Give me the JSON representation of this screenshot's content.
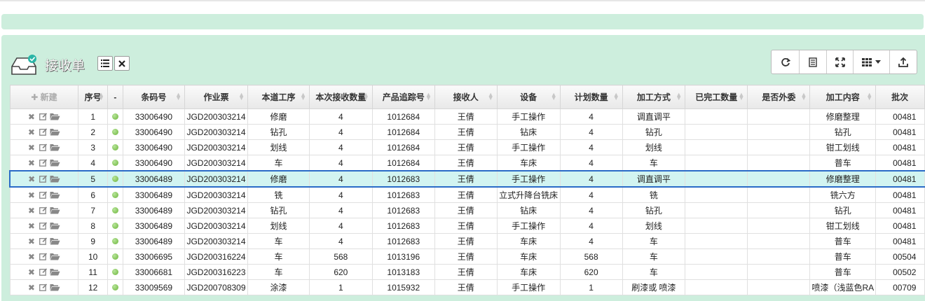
{
  "panel": {
    "title": "接收单",
    "list_icon": "list-icon",
    "close_icon": "close-icon"
  },
  "toolbar": {
    "items": [
      "refresh-icon",
      "document-icon",
      "fullscreen-icon",
      "grid-columns-dropdown-icon",
      "export-icon"
    ]
  },
  "table": {
    "new_label": "新建",
    "columns": [
      "序号",
      "-",
      "条码号",
      "作业票",
      "本道工序",
      "本次接收数量",
      "产品追踪号",
      "接收人",
      "设备",
      "计划数量",
      "加工方式",
      "已完工数量",
      "是否外委",
      "加工内容",
      "批次"
    ],
    "rows": [
      {
        "seq": "1",
        "barcode": "33006490",
        "ticket": "JGD200303214",
        "process": "修磨",
        "qty": "4",
        "track": "1012684",
        "receiver": "王倩",
        "device": "手工操作",
        "plan": "4",
        "method": "调直调平",
        "done": "",
        "outsource": "",
        "content": "修磨整理",
        "batch": "00481"
      },
      {
        "seq": "2",
        "barcode": "33006490",
        "ticket": "JGD200303214",
        "process": "钻孔",
        "qty": "4",
        "track": "1012684",
        "receiver": "王倩",
        "device": "钻床",
        "plan": "4",
        "method": "钻孔",
        "done": "",
        "outsource": "",
        "content": "钻孔",
        "batch": "00481"
      },
      {
        "seq": "3",
        "barcode": "33006490",
        "ticket": "JGD200303214",
        "process": "划线",
        "qty": "4",
        "track": "1012684",
        "receiver": "王倩",
        "device": "手工操作",
        "plan": "4",
        "method": "划线",
        "done": "",
        "outsource": "",
        "content": "钳工划线",
        "batch": "00481"
      },
      {
        "seq": "4",
        "barcode": "33006490",
        "ticket": "JGD200303214",
        "process": "车",
        "qty": "4",
        "track": "1012684",
        "receiver": "王倩",
        "device": "车床",
        "plan": "4",
        "method": "车",
        "done": "",
        "outsource": "",
        "content": "普车",
        "batch": "00481"
      },
      {
        "seq": "5",
        "barcode": "33006489",
        "ticket": "JGD200303214",
        "process": "修磨",
        "qty": "4",
        "track": "1012683",
        "receiver": "王倩",
        "device": "手工操作",
        "plan": "4",
        "method": "调直调平",
        "done": "",
        "outsource": "",
        "content": "修磨整理",
        "batch": "00481"
      },
      {
        "seq": "6",
        "barcode": "33006489",
        "ticket": "JGD200303214",
        "process": "铣",
        "qty": "4",
        "track": "1012683",
        "receiver": "王倩",
        "device": "立式升降台铣床",
        "plan": "4",
        "method": "铣",
        "done": "",
        "outsource": "",
        "content": "铣六方",
        "batch": "00481"
      },
      {
        "seq": "7",
        "barcode": "33006489",
        "ticket": "JGD200303214",
        "process": "钻孔",
        "qty": "4",
        "track": "1012683",
        "receiver": "王倩",
        "device": "钻床",
        "plan": "4",
        "method": "钻孔",
        "done": "",
        "outsource": "",
        "content": "钻孔",
        "batch": "00481"
      },
      {
        "seq": "8",
        "barcode": "33006489",
        "ticket": "JGD200303214",
        "process": "划线",
        "qty": "4",
        "track": "1012683",
        "receiver": "王倩",
        "device": "手工操作",
        "plan": "4",
        "method": "划线",
        "done": "",
        "outsource": "",
        "content": "钳工划线",
        "batch": "00481"
      },
      {
        "seq": "9",
        "barcode": "33006489",
        "ticket": "JGD200303214",
        "process": "车",
        "qty": "4",
        "track": "1012683",
        "receiver": "王倩",
        "device": "车床",
        "plan": "4",
        "method": "车",
        "done": "",
        "outsource": "",
        "content": "普车",
        "batch": "00481"
      },
      {
        "seq": "10",
        "barcode": "33006695",
        "ticket": "JGD200316224",
        "process": "车",
        "qty": "568",
        "track": "1013196",
        "receiver": "王倩",
        "device": "车床",
        "plan": "568",
        "method": "车",
        "done": "",
        "outsource": "",
        "content": "普车",
        "batch": "00504"
      },
      {
        "seq": "11",
        "barcode": "33006681",
        "ticket": "JGD200316223",
        "process": "车",
        "qty": "620",
        "track": "1013183",
        "receiver": "王倩",
        "device": "车床",
        "plan": "620",
        "method": "车",
        "done": "",
        "outsource": "",
        "content": "普车",
        "batch": "00502"
      },
      {
        "seq": "12",
        "barcode": "33009569",
        "ticket": "JGD200708309",
        "process": "涂漆",
        "qty": "1",
        "track": "1015932",
        "receiver": "王倩",
        "device": "手工操作",
        "plan": "1",
        "method": "刷漆或 喷漆",
        "done": "",
        "outsource": "",
        "content": "喷漆（浅蓝色RA",
        "batch": "00709"
      }
    ],
    "selected_index": 4
  },
  "colors": {
    "panel_bg": "#cdeedd",
    "selected_row_bg": "#d2f4f1",
    "selected_row_border": "#2a6bc7",
    "status_dot": "#6cb43a"
  }
}
